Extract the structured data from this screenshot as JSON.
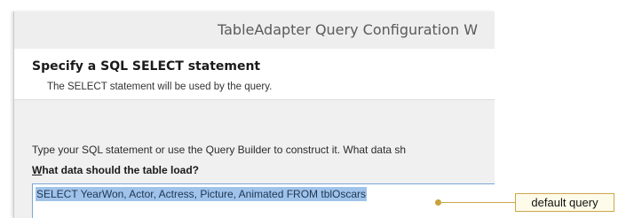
{
  "window": {
    "title": "TableAdapter Query Configuration W"
  },
  "header": {
    "heading": "Specify a SQL SELECT statement",
    "subtitle": "The SELECT statement will be used by the query."
  },
  "body": {
    "instructions": "Type your SQL statement or use the Query Builder to construct it. What data sh",
    "label_hotkey": "W",
    "label_rest": "hat data should the table load?",
    "sql_text": "SELECT YearWon, Actor, Actress, Picture, Animated FROM tblOscars"
  },
  "annotation": {
    "callout": "default query"
  },
  "colors": {
    "selection": "#9fc3ea",
    "callout_border": "#caa84a",
    "input_border": "#7aa7d6"
  }
}
